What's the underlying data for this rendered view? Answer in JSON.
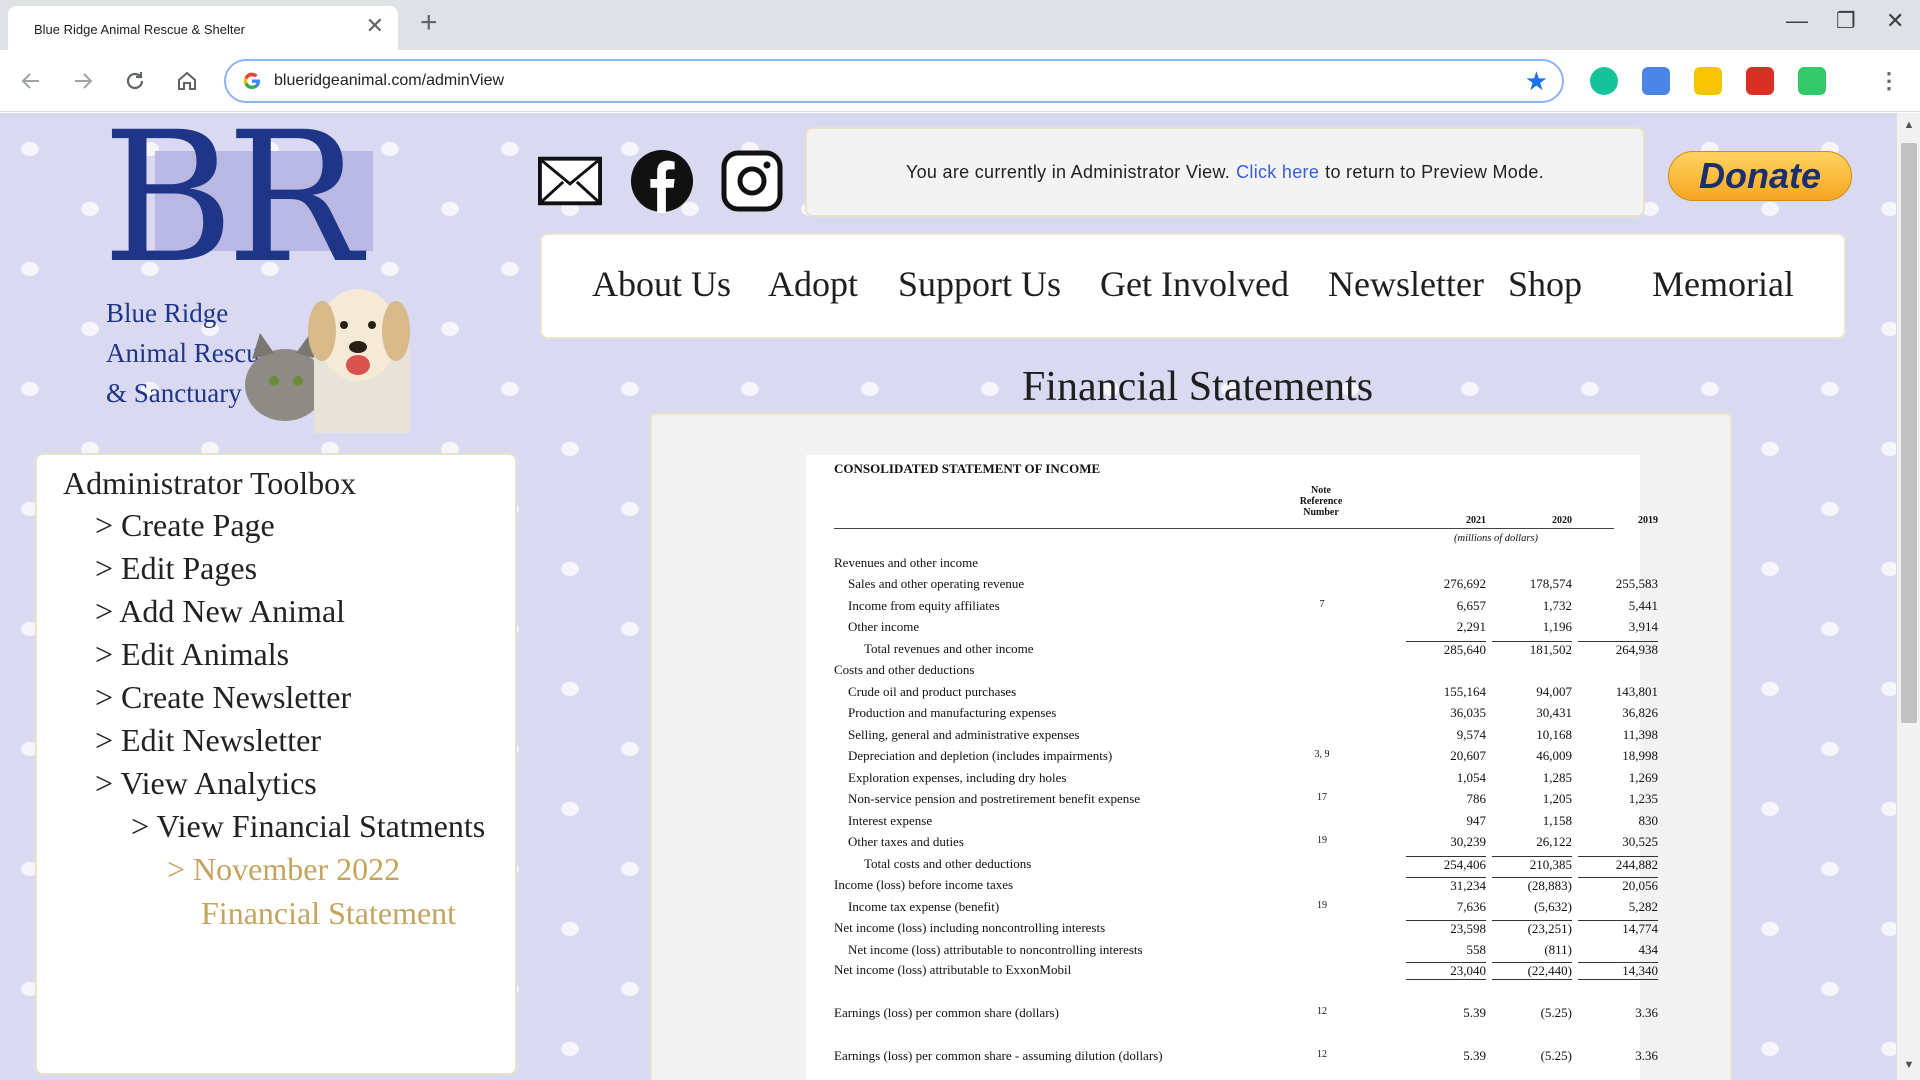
{
  "browser": {
    "tab_title": "Blue Ridge Animal Rescue & Shelter",
    "url": "blueridgeanimal.com/adminView"
  },
  "logo": {
    "letters": "BR",
    "line1": "Blue Ridge",
    "line2": "Animal Rescue",
    "line3": "& Sanctuary"
  },
  "admin_banner": {
    "before": "You are currently in Administrator View.",
    "link": "Click here",
    "after": "to return to Preview Mode."
  },
  "donate_label": "Donate",
  "nav": [
    "About Us",
    "Adopt",
    "Support Us",
    "Get Involved",
    "Newsletter",
    "Shop",
    "Memorial"
  ],
  "page_title": "Financial Statements",
  "toolbox": {
    "heading": "Administrator Toolbox",
    "items": [
      "> Create Page",
      "> Edit Pages",
      "> Add New Animal",
      "> Edit Animals",
      "> Create Newsletter",
      "> Edit Newsletter",
      "> View Analytics",
      "> View Financial Statments",
      "> November 2022",
      "Financial Statement"
    ]
  },
  "statement": {
    "title": "CONSOLIDATED STATEMENT OF INCOME",
    "note_header": [
      "Note",
      "Reference",
      "Number"
    ],
    "years": [
      "2021",
      "2020",
      "2019"
    ],
    "units": "(millions of dollars)",
    "rows": [
      {
        "label": "Revenues and other income",
        "note": "",
        "v": [
          "",
          "",
          ""
        ]
      },
      {
        "label": "Sales and other operating revenue",
        "note": "",
        "v": [
          "276,692",
          "178,574",
          "255,583"
        ]
      },
      {
        "label": "Income from equity affiliates",
        "note": "7",
        "v": [
          "6,657",
          "1,732",
          "5,441"
        ]
      },
      {
        "label": "Other income",
        "note": "",
        "v": [
          "2,291",
          "1,196",
          "3,914"
        ]
      },
      {
        "label": "Total revenues and other income",
        "note": "",
        "v": [
          "285,640",
          "181,502",
          "264,938"
        ]
      },
      {
        "label": "Costs and other deductions",
        "note": "",
        "v": [
          "",
          "",
          ""
        ]
      },
      {
        "label": "Crude oil and product purchases",
        "note": "",
        "v": [
          "155,164",
          "94,007",
          "143,801"
        ]
      },
      {
        "label": "Production and manufacturing expenses",
        "note": "",
        "v": [
          "36,035",
          "30,431",
          "36,826"
        ]
      },
      {
        "label": "Selling, general and administrative expenses",
        "note": "",
        "v": [
          "9,574",
          "10,168",
          "11,398"
        ]
      },
      {
        "label": "Depreciation and depletion (includes impairments)",
        "note": "3, 9",
        "v": [
          "20,607",
          "46,009",
          "18,998"
        ]
      },
      {
        "label": "Exploration expenses, including dry holes",
        "note": "",
        "v": [
          "1,054",
          "1,285",
          "1,269"
        ]
      },
      {
        "label": "Non-service pension and postretirement benefit expense",
        "note": "17",
        "v": [
          "786",
          "1,205",
          "1,235"
        ]
      },
      {
        "label": "Interest expense",
        "note": "",
        "v": [
          "947",
          "1,158",
          "830"
        ]
      },
      {
        "label": "Other taxes and duties",
        "note": "19",
        "v": [
          "30,239",
          "26,122",
          "30,525"
        ]
      },
      {
        "label": "Total costs and other deductions",
        "note": "",
        "v": [
          "254,406",
          "210,385",
          "244,882"
        ]
      },
      {
        "label": "Income (loss) before income taxes",
        "note": "",
        "v": [
          "31,234",
          "(28,883)",
          "20,056"
        ]
      },
      {
        "label": "Income tax expense (benefit)",
        "note": "19",
        "v": [
          "7,636",
          "(5,632)",
          "5,282"
        ]
      },
      {
        "label": "Net income (loss) including noncontrolling interests",
        "note": "",
        "v": [
          "23,598",
          "(23,251)",
          "14,774"
        ]
      },
      {
        "label": "Net income (loss) attributable to noncontrolling interests",
        "note": "",
        "v": [
          "558",
          "(811)",
          "434"
        ]
      },
      {
        "label": "Net income (loss) attributable to ExxonMobil",
        "note": "",
        "v": [
          "23,040",
          "(22,440)",
          "14,340"
        ]
      },
      {
        "label": "Earnings (loss) per common share (dollars)",
        "note": "12",
        "v": [
          "5.39",
          "(5.25)",
          "3.36"
        ]
      },
      {
        "label": "Earnings (loss) per common share - assuming dilution (dollars)",
        "note": "12",
        "v": [
          "5.39",
          "(5.25)",
          "3.36"
        ]
      }
    ]
  },
  "colors": {
    "page_bg": "#d9d9f1",
    "brand_navy": "#1f3588",
    "gold_link": "#c6a45f",
    "link_blue": "#3a5bd6"
  }
}
